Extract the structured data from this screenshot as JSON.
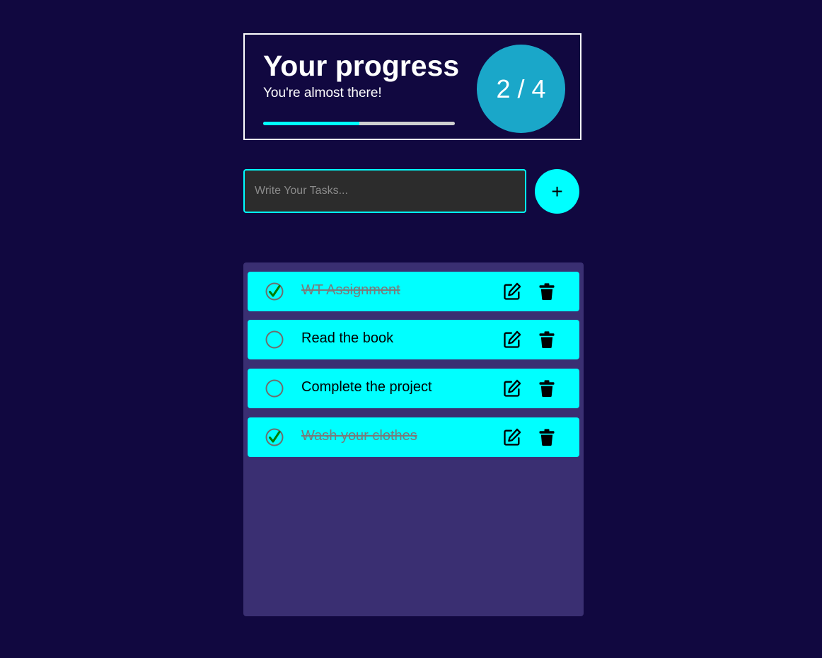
{
  "progress": {
    "title": "Your progress",
    "subtitle": "You're almost there!",
    "counter": "2 / 4",
    "fill_fraction": 0.5
  },
  "input": {
    "placeholder": "Write Your Tasks...",
    "value": ""
  },
  "add_button": {
    "label": "+"
  },
  "tasks": [
    {
      "text": "WT Assignment",
      "done": true
    },
    {
      "text": "Read the book",
      "done": false
    },
    {
      "text": "Complete the project",
      "done": false
    },
    {
      "text": "Wash your clothes",
      "done": true
    }
  ],
  "icons": {
    "check": "check-circle-icon",
    "edit": "edit-icon",
    "delete": "trash-icon"
  },
  "colors": {
    "background": "#110840",
    "accent": "#00ffff",
    "circle": "#1aa7c9",
    "panel": "#3a2f72",
    "check": "#008000"
  }
}
